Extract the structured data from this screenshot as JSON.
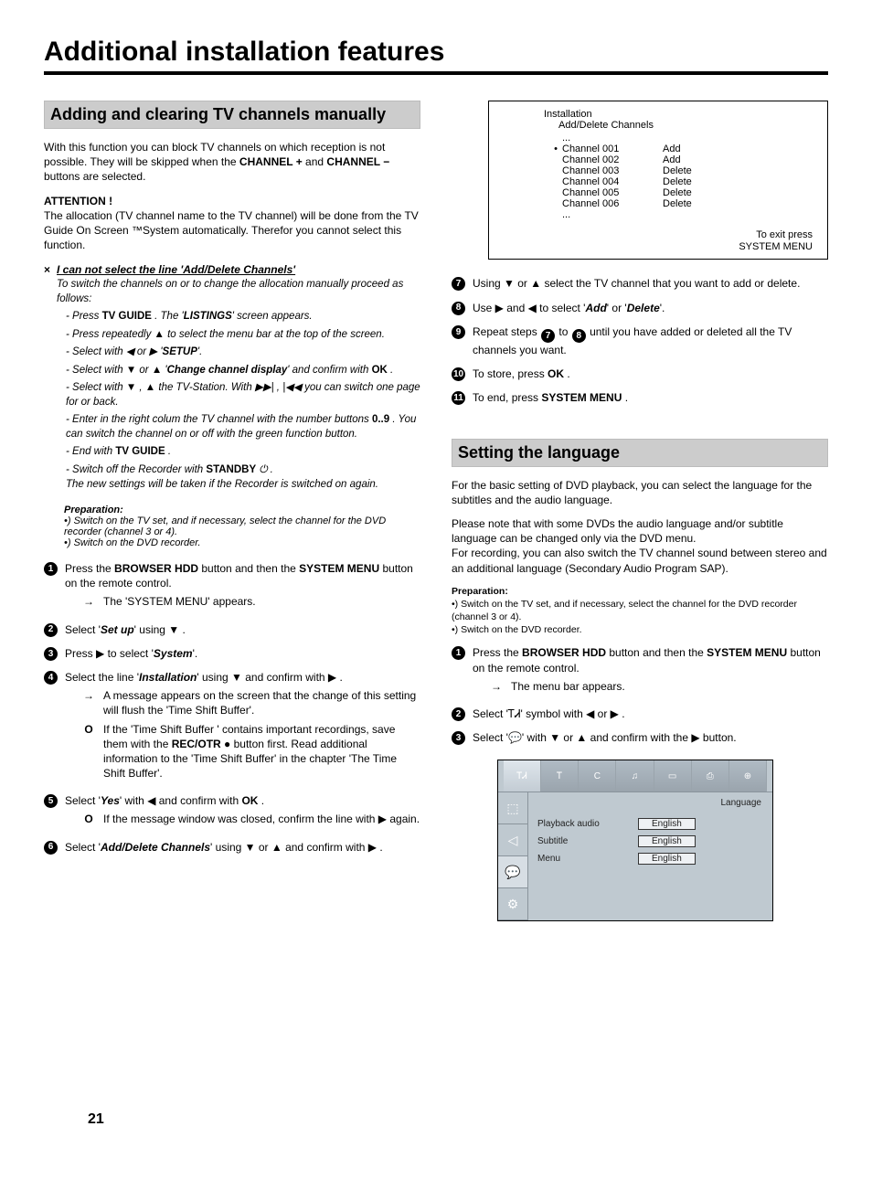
{
  "page": {
    "title": "Additional installation features",
    "number": "21"
  },
  "left": {
    "section_heading": "Adding and clearing TV channels manually",
    "intro_a": "With this function you can block TV channels on which reception is not possible. They will be skipped when the ",
    "intro_b": "CHANNEL +",
    "intro_c": " and ",
    "intro_d": "CHANNEL −",
    "intro_e": "  buttons are selected.",
    "attention_label": "ATTENTION !",
    "attention_body": "The allocation (TV channel name to the TV channel) will be done from the TV Guide On Screen ™System automatically. Therefor you cannot select this function.",
    "trouble": {
      "title": "I can not select the line 'Add/Delete Channels'",
      "lead": "To switch the channels on or to change the allocation manually proceed as follows:",
      "s1a": "- Press ",
      "s1b": "TV GUIDE",
      "s1c": " . The '",
      "s1d": "LISTINGS",
      "s1e": "' screen appears.",
      "s2": "- Press repeatedly  ▲  to select the menu bar at the top of the screen.",
      "s3a": "- Select with  ◀  or  ▶  '",
      "s3b": "SETUP",
      "s3c": "'.",
      "s4a": "- Select with  ▼  or  ▲  '",
      "s4b": "Change channel display",
      "s4c": "' and confirm with  ",
      "s4d": "OK",
      "s4e": " .",
      "s5": "- Select with  ▼ ,  ▲  the TV-Station. With  ▶▶| ,  |◀◀  you can switch one page for or back.",
      "s6a": "- Enter in the right colum the TV channel with the number buttons ",
      "s6b": "0..9",
      "s6c": " . You can switch the channel on or off with the green function button.",
      "s7a": "- End with  ",
      "s7b": "TV GUIDE",
      "s7c": " .",
      "s8a": "- Switch off the Recorder with  ",
      "s8b": "STANDBY",
      "s8c": " ⏻ .",
      "s8d": "The new settings will be taken if the Recorder is switched on again."
    },
    "prep": {
      "title": "Preparation:",
      "l1": "•) Switch on the TV set, and if necessary, select the channel for the DVD recorder (channel 3 or 4).",
      "l2": "•) Switch on the DVD recorder."
    },
    "steps": {
      "s1a": "Press the  ",
      "s1b": "BROWSER HDD",
      "s1c": "  button and then the  ",
      "s1d": "SYSTEM MENU",
      "s1e": "  button on the remote control.",
      "s1sub": "The 'SYSTEM MENU' appears.",
      "s2a": "Select '",
      "s2b": "Set up",
      "s2c": "' using  ▼ .",
      "s3a": "Press  ▶  to select '",
      "s3b": "System",
      "s3c": "'.",
      "s4a": "Select the line '",
      "s4b": "Installation",
      "s4c": "' using  ▼  and confirm with  ▶ .",
      "s4sub1": "A message appears on the screen that the change of this setting will flush the 'Time Shift Buffer'.",
      "s4sub2a": "If the 'Time Shift Buffer ' contains important recordings, save them with the  ",
      "s4sub2b": "REC/OTR",
      "s4sub2c": " ●  button first. Read additional information to the 'Time Shift Buffer' in the chapter 'The Time Shift Buffer'.",
      "s5a": "Select '",
      "s5b": "Yes",
      "s5c": "' with  ◀  and confirm with  ",
      "s5d": "OK",
      "s5e": " .",
      "s5sub": "If the message window was closed, confirm the line with ▶  again.",
      "s6a": "Select '",
      "s6b": "Add/Delete Channels",
      "s6c": "' using  ▼  or  ▲  and confirm with ▶ ."
    }
  },
  "right": {
    "osd": {
      "title": "Installation",
      "sub": "Add/Delete Channels",
      "dots": "...",
      "rows": [
        {
          "chan": "Channel 001",
          "act": "Add"
        },
        {
          "chan": "Channel 002",
          "act": "Add"
        },
        {
          "chan": "Channel 003",
          "act": "Delete"
        },
        {
          "chan": "Channel 004",
          "act": "Delete"
        },
        {
          "chan": "Channel 005",
          "act": "Delete"
        },
        {
          "chan": "Channel 006",
          "act": "Delete"
        }
      ],
      "exit1": "To exit press",
      "exit2": "SYSTEM MENU"
    },
    "steps": {
      "s7": "Using  ▼  or  ▲  select the TV channel that you want to add or delete.",
      "s8a": "Use  ▶  and  ◀  to select '",
      "s8b": "Add",
      "s8c": "' or '",
      "s8d": "Delete",
      "s8e": "'.",
      "s9a": "Repeat steps ",
      "s9b": " to ",
      "s9c": " until you have added or deleted all the TV channels you want.",
      "s10a": "To store, press  ",
      "s10b": "OK",
      "s10c": " .",
      "s11a": "To end, press  ",
      "s11b": "SYSTEM MENU",
      "s11c": " ."
    },
    "lang": {
      "heading": "Setting the language",
      "p1": "For the basic setting of DVD playback, you can select the language for the subtitles and the audio language.",
      "p2": "Please note that with some DVDs the audio language and/or subtitle language can be changed only via the DVD menu.",
      "p3": "For recording, you can also switch the TV channel sound between stereo and an additional language (Secondary Audio Program SAP).",
      "prep_title": "Preparation:",
      "prep_l1": "•) Switch on the TV set, and if necessary, select the channel for the DVD recorder (channel 3 or 4).",
      "prep_l2": "•) Switch on the DVD recorder.",
      "s1a": "Press the  ",
      "s1b": "BROWSER HDD",
      "s1c": "  button and then the  ",
      "s1d": "SYSTEM MENU",
      "s1e": "  button on the remote control.",
      "s1sub": "The menu bar appears.",
      "s2": "Select 'ᎢᏗ' symbol with  ◀  or  ▶ .",
      "s3": "Select '💬' with  ▼  or  ▲  and confirm with the  ▶  button."
    },
    "osd2": {
      "lang_label": "Language",
      "rows": [
        {
          "lbl": "Playback audio",
          "val": "English"
        },
        {
          "lbl": "Subtitle",
          "val": "English"
        },
        {
          "lbl": "Menu",
          "val": "English"
        }
      ]
    }
  },
  "badges": {
    "n7": "7",
    "n8": "8"
  }
}
